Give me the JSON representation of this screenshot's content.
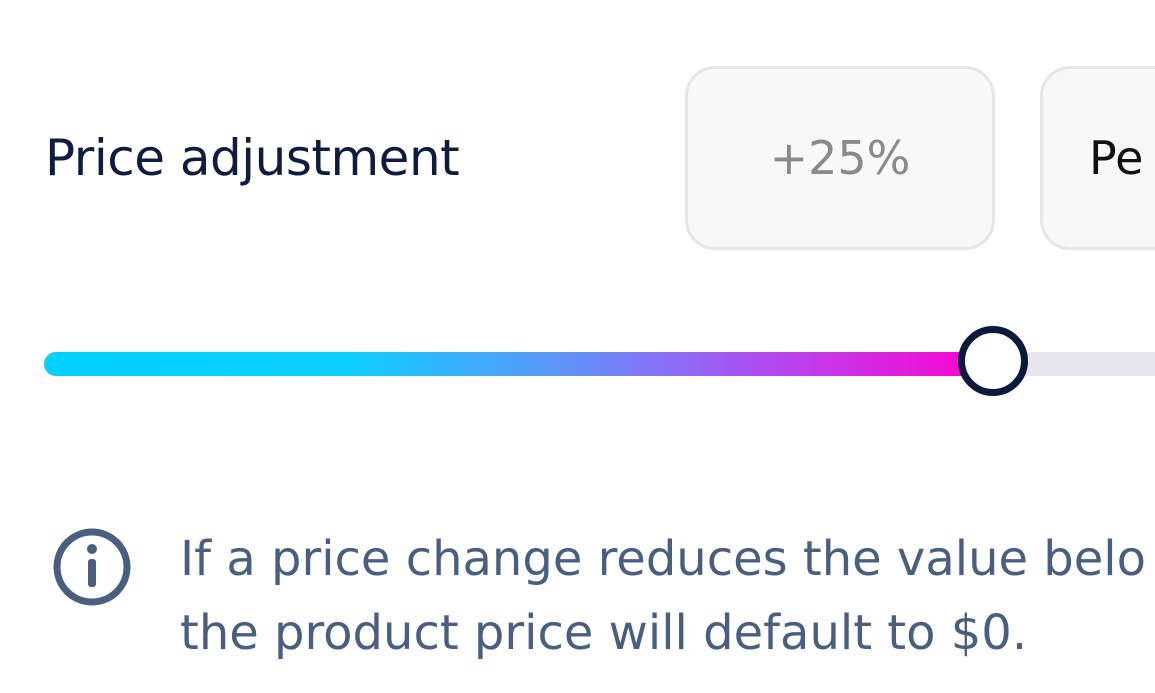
{
  "price_adjustment": {
    "label": "Price adjustment",
    "value_display": "+25%",
    "unit_select_visible_text": "Pe",
    "slider": {
      "level": 0.84,
      "fill_gradient": [
        "#00d1ff",
        "#6b8af7",
        "#ff00cc"
      ],
      "track_color": "#e7e7ec",
      "thumb_border_color": "#0a1a3a"
    }
  },
  "info": {
    "icon": "info-icon",
    "line1": "If a price change reduces the value belo",
    "line2": "the product price will default to $0."
  },
  "colors": {
    "label": "#0f1c3f",
    "info_text": "#4a5f80",
    "box_bg": "#f8f8f8",
    "box_border": "#e6e6e6"
  }
}
